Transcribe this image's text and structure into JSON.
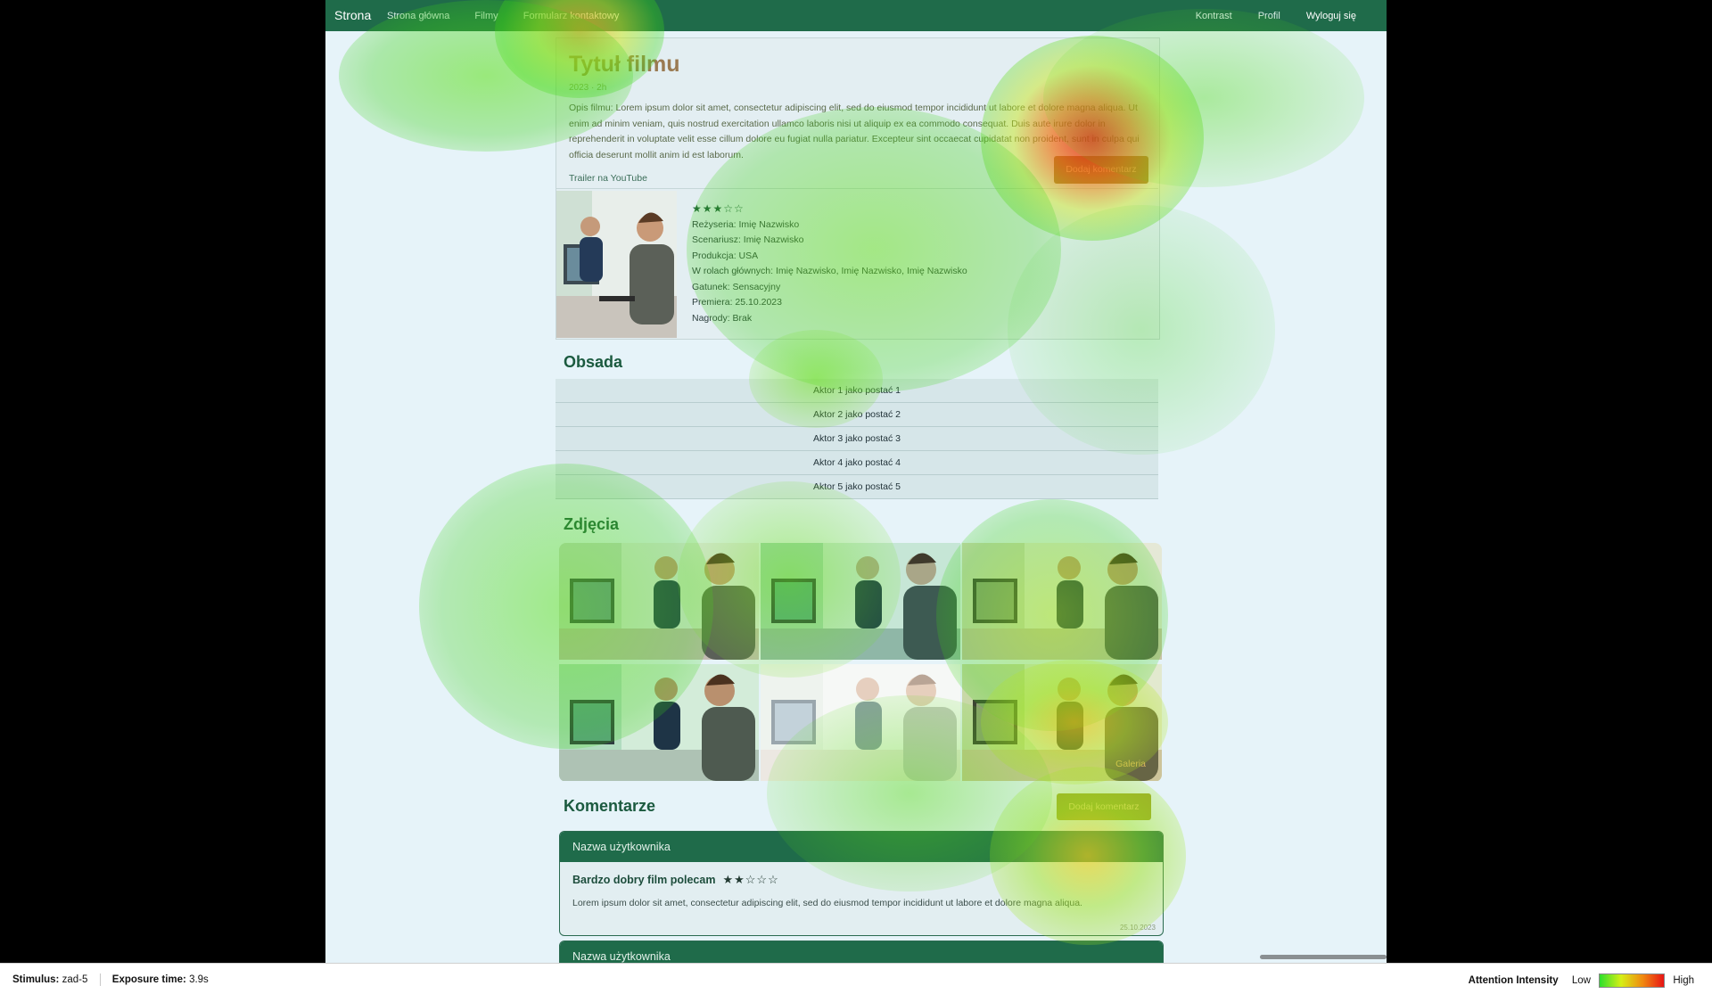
{
  "navbar": {
    "brand": "Strona",
    "links": [
      "Strona główna",
      "Filmy",
      "Formularz kontaktowy"
    ],
    "right": [
      "Kontrast",
      "Profil",
      "Wyloguj się"
    ]
  },
  "movie": {
    "title": "Tytuł filmu",
    "meta": "2023 · 2h",
    "description": "Opis filmu: Lorem ipsum dolor sit amet, consectetur adipiscing elit, sed do eiusmod tempor incididunt ut labore et dolore magna aliqua. Ut enim ad minim veniam, quis nostrud exercitation ullamco laboris nisi ut aliquip ex ea commodo consequat. Duis aute irure dolor in reprehenderit in voluptate velit esse cillum dolore eu fugiat nulla pariatur. Excepteur sint occaecat cupidatat non proident, sunt in culpa qui officia deserunt mollit anim id est laborum.",
    "trailer": "Trailer na YouTube",
    "add_comment": "Dodaj komentarz",
    "stars": "★★★☆☆",
    "details": [
      "Reżyseria: Imię Nazwisko",
      "Scenariusz: Imię Nazwisko",
      "Produkcja: USA",
      "W rolach głównych: Imię Nazwisko, Imię Nazwisko, Imię Nazwisko",
      "Gatunek: Sensacyjny",
      "Premiera: 25.10.2023",
      "Nagrody: Brak"
    ]
  },
  "cast": {
    "title": "Obsada",
    "rows": [
      "Aktor 1 jako postać 1",
      "Aktor 2 jako postać 2",
      "Aktor 3 jako postać 3",
      "Aktor 4 jako postać 4",
      "Aktor 5 jako postać 5"
    ]
  },
  "photos": {
    "title": "Zdjęcia",
    "gallery_label": "Galeria"
  },
  "comments": {
    "title": "Komentarze",
    "add_comment": "Dodaj komentarz",
    "items": [
      {
        "user": "Nazwa użytkownika",
        "title": "Bardzo dobry film polecam",
        "stars": "★★☆☆☆",
        "text": "Lorem ipsum dolor sit amet, consectetur adipiscing elit, sed do eiusmod tempor incididunt ut labore et dolore magna aliqua.",
        "date": "25.10.2023"
      },
      {
        "user": "Nazwa użytkownika"
      }
    ]
  },
  "status": {
    "stimulus_label": "Stimulus:",
    "stimulus_value": "zad-5",
    "exposure_label": "Exposure time:",
    "exposure_value": "3.9s",
    "legend_title": "Attention Intensity",
    "legend_low": "Low",
    "legend_high": "High"
  }
}
